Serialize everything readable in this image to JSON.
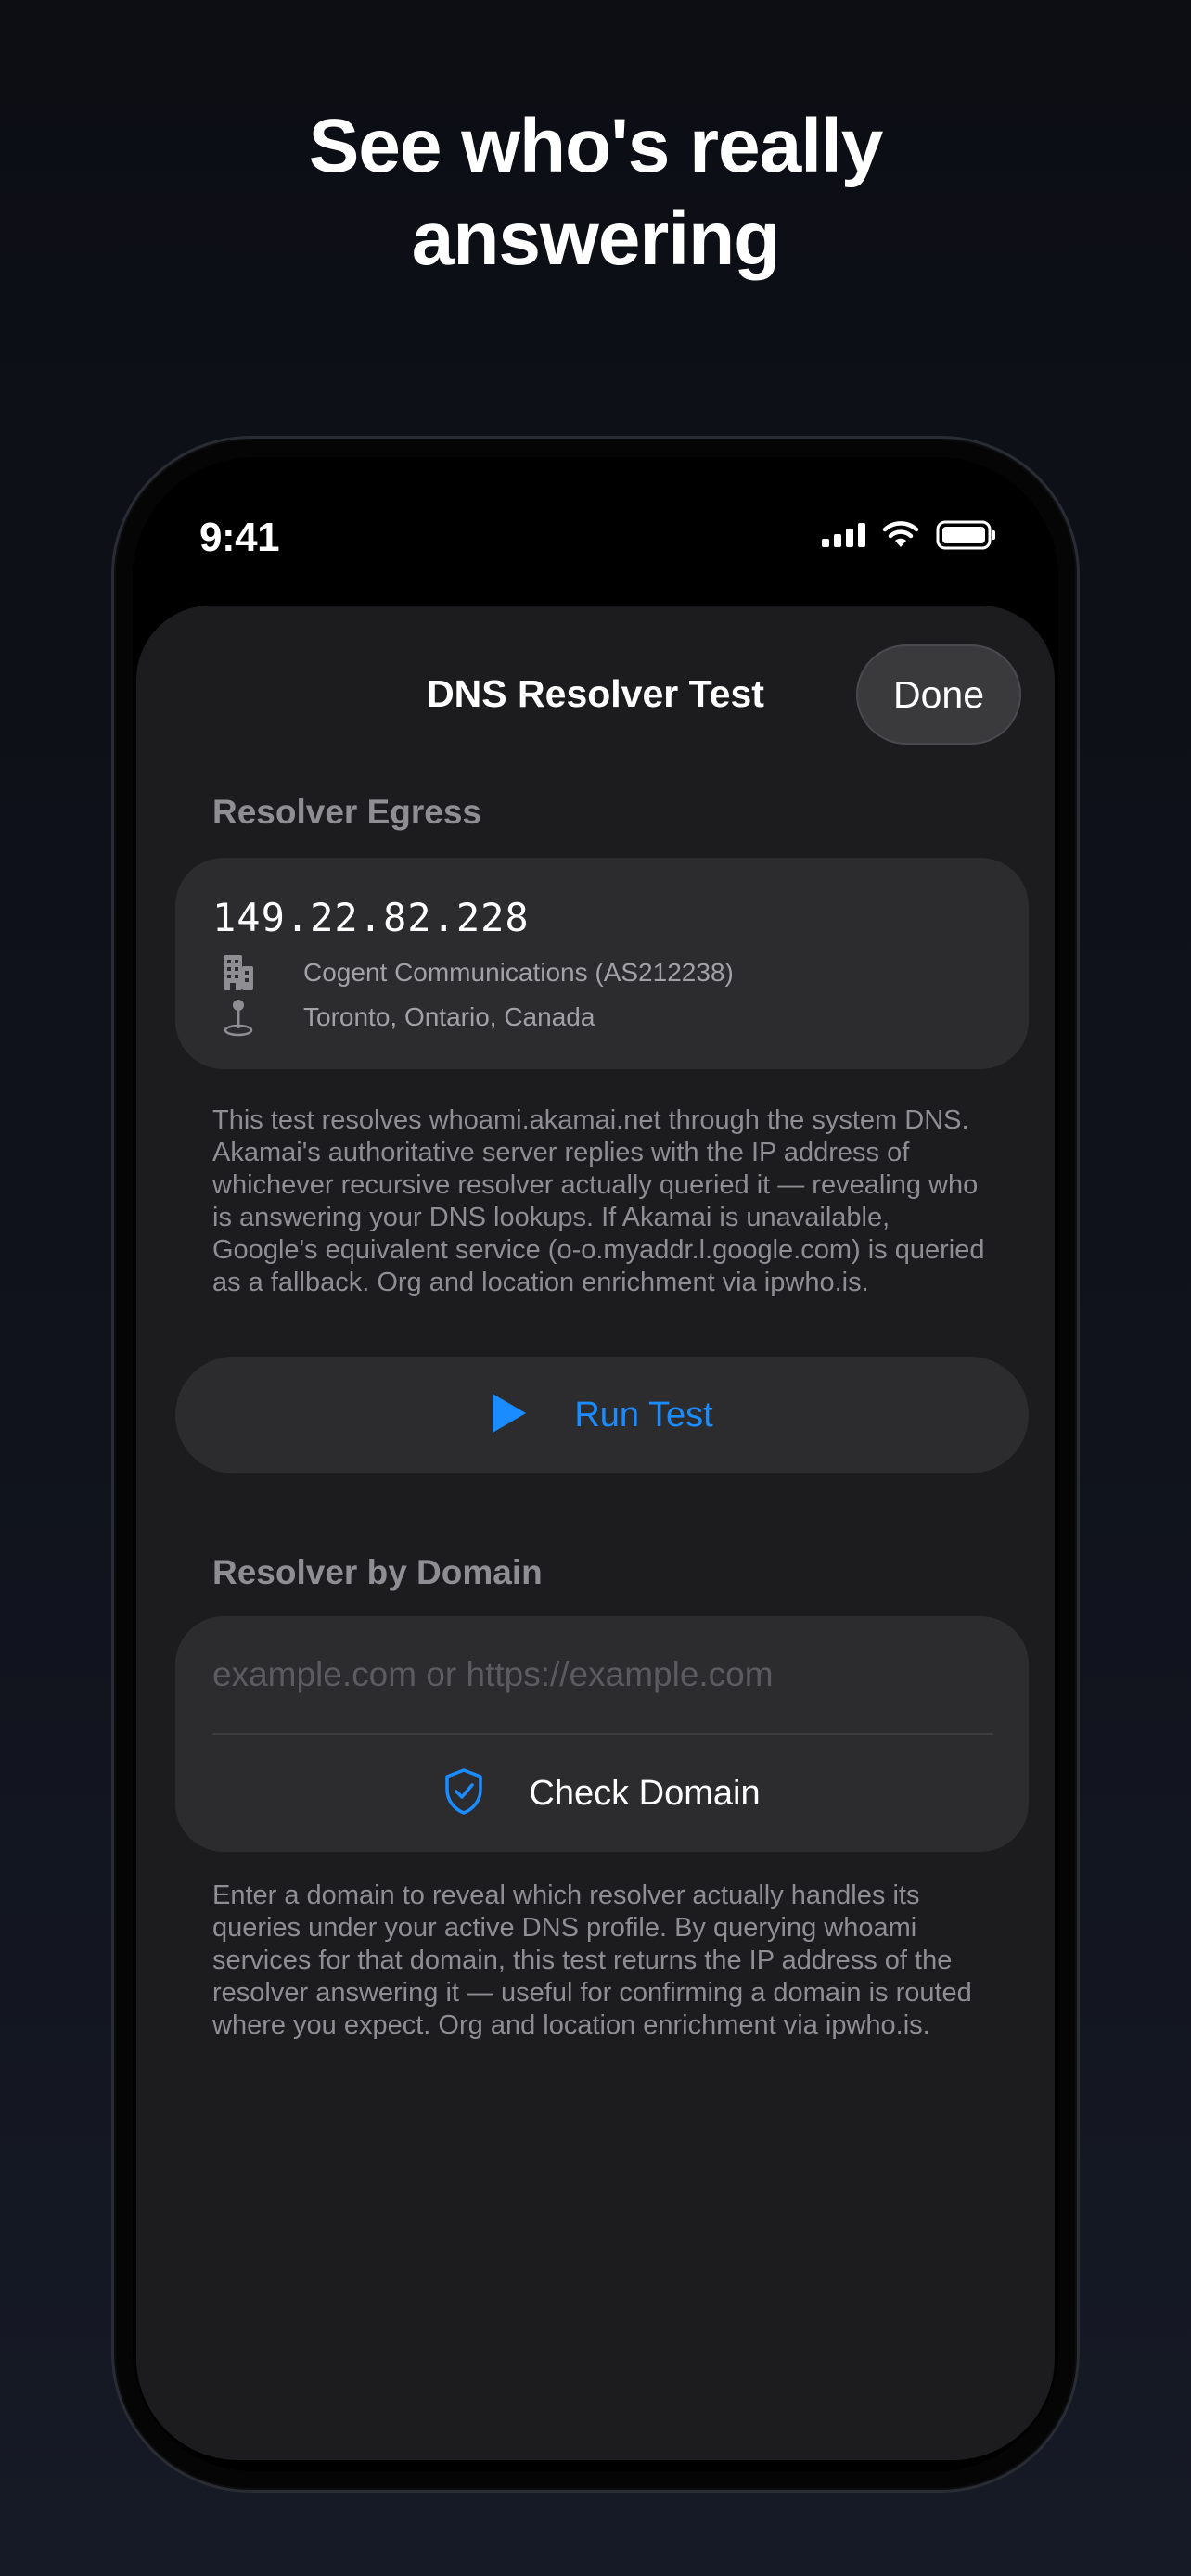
{
  "headline": {
    "line1": "See who's really",
    "line2": "answering"
  },
  "status_bar": {
    "time": "9:41"
  },
  "sheet": {
    "title": "DNS Resolver Test",
    "done_label": "Done"
  },
  "resolver_egress": {
    "header": "Resolver Egress",
    "ip": "149.22.82.228",
    "org": "Cogent Communications (AS212238)",
    "location": "Toronto, Ontario, Canada",
    "footnote": "This test resolves whoami.akamai.net through the system DNS. Akamai's authoritative server replies with the IP address of whichever recursive resolver actually queried it — revealing who is answering your DNS lookups. If Akamai is unavailable, Google's equivalent service (o-o.myaddr.l.google.com) is queried as a fallback. Org and location enrichment via ipwho.is.",
    "run_label": "Run Test"
  },
  "resolver_by_domain": {
    "header": "Resolver by Domain",
    "placeholder": "example.com or https://example.com",
    "value": "",
    "check_label": "Check Domain",
    "footnote": "Enter a domain to reveal which resolver actually handles its queries under your active DNS profile. By querying whoami services for that domain, this test returns the IP address of the resolver answering it — useful for confirming a domain is routed where you expect. Org and location enrichment via ipwho.is."
  },
  "icons": {
    "building": "building-icon",
    "location": "location-pin-icon",
    "play": "play-icon",
    "shield": "shield-check-icon"
  },
  "colors": {
    "accent": "#1a8cff",
    "card": "#2c2c2e",
    "sheet": "#1c1c1e",
    "secondary_text": "#8e8e93"
  }
}
